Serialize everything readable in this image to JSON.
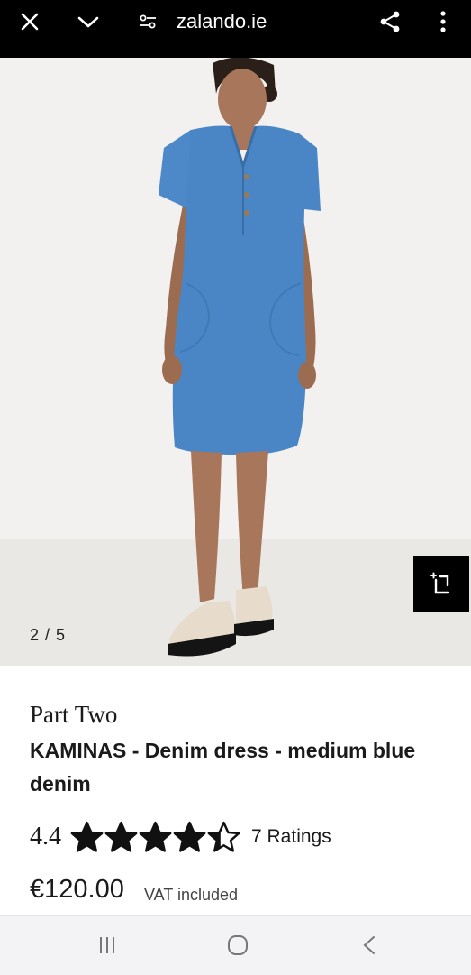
{
  "browser": {
    "url": "zalando.ie",
    "icons": [
      "close-icon",
      "chevron-down-icon",
      "site-settings-icon",
      "share-icon",
      "more-vert-icon"
    ]
  },
  "gallery": {
    "counter": "2 / 5",
    "expand_icon": "expand-icon"
  },
  "product": {
    "brand": "Part Two",
    "title": "KAMINAS - Denim dress - medium blue denim",
    "rating_value": "4.4",
    "rating_stars": 4.4,
    "ratings_count": "7 Ratings",
    "price": "€120.00",
    "vat_note": "VAT included"
  },
  "colors": {
    "topbar": "#000000",
    "photo_bg": "#f2f1ef",
    "denim": "#4a86c5",
    "text": "#1a1a1a"
  },
  "system_nav": {
    "icons": [
      "recent-apps-icon",
      "home-icon",
      "back-icon"
    ]
  }
}
